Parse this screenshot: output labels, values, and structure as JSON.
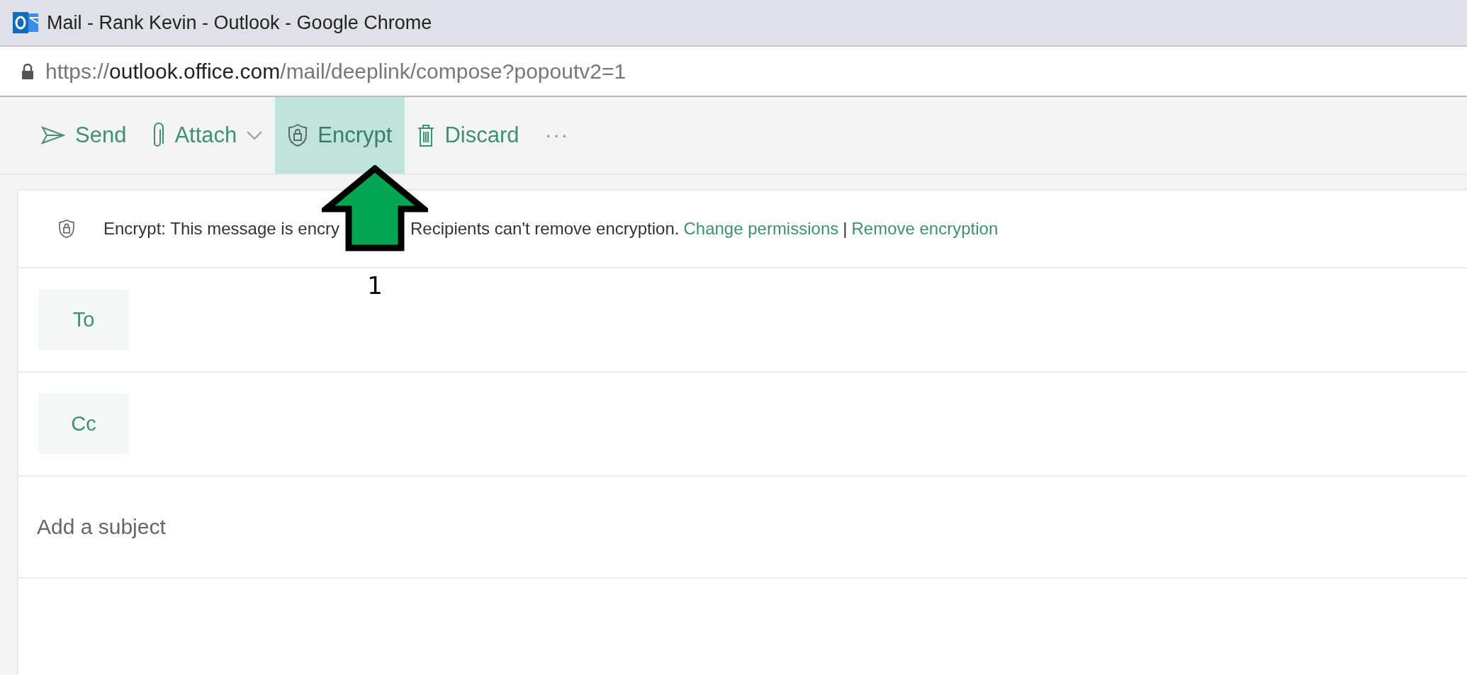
{
  "window": {
    "title": "Mail - Rank Kevin - Outlook - Google Chrome"
  },
  "address_bar": {
    "scheme": "https://",
    "host": "outlook.office.com",
    "path": "/mail/deeplink/compose?popoutv2=1"
  },
  "toolbar": {
    "buttons": [
      {
        "kind": "send",
        "label": "Send",
        "dropdown": false,
        "selected": false
      },
      {
        "kind": "attach",
        "label": "Attach",
        "dropdown": true,
        "selected": false
      },
      {
        "kind": "encrypt",
        "label": "Encrypt",
        "dropdown": false,
        "selected": true
      },
      {
        "kind": "discard",
        "label": "Discard",
        "dropdown": false,
        "selected": false
      },
      {
        "kind": "more",
        "label": "···",
        "dropdown": false,
        "selected": false
      }
    ]
  },
  "notice": {
    "text_before": "Encrypt: This message is encry",
    "text_after": "Recipients can't remove encryption.",
    "links": [
      "Change permissions",
      "Remove encryption"
    ],
    "separator": "|"
  },
  "fields": [
    {
      "kind": "recipient",
      "label": "To"
    },
    {
      "kind": "recipient",
      "label": "Cc"
    },
    {
      "kind": "subject",
      "placeholder": "Add a subject"
    }
  ],
  "annotation": {
    "label": "1"
  }
}
